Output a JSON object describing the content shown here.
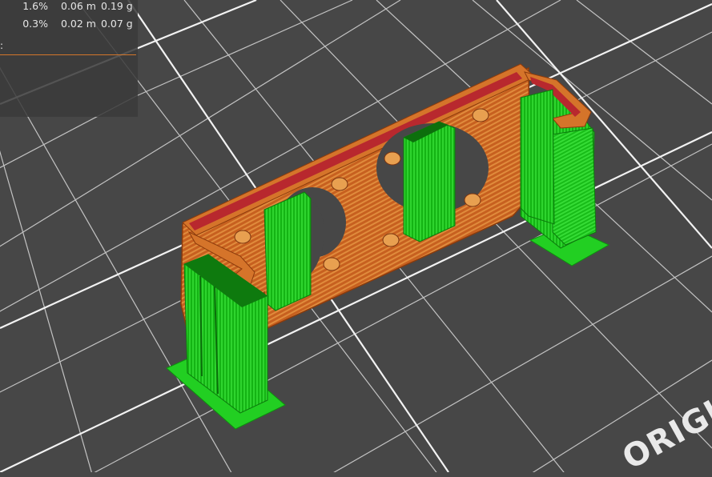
{
  "legend": {
    "rows": [
      {
        "percent": "1.6%",
        "length": "0.06 m",
        "weight": "0.19 g"
      },
      {
        "percent": "0.3%",
        "length": "0.02 m",
        "weight": "0.07 g"
      }
    ],
    "separator_label": ":"
  },
  "bed_logo_text": "ORIGI",
  "colors": {
    "background": "#474747",
    "bed_grid": "#e8e8e8",
    "perimeter_orange": "#c8601e",
    "support_green": "#1ec81e",
    "overhang_red": "#b8282e",
    "accent": "#d2762b"
  }
}
